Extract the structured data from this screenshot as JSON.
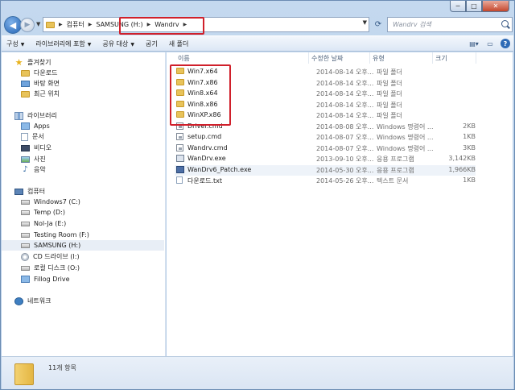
{
  "window": {
    "caption_buttons": {
      "minimize": "─",
      "maximize": "□",
      "close": "✕"
    }
  },
  "address": {
    "crumbs": [
      "컴퓨터",
      "SAMSUNG (H:)",
      "Wandrv"
    ],
    "search_placeholder": "Wandrv 검색"
  },
  "toolbar": {
    "items": [
      {
        "label": "구성",
        "has_caret": true
      },
      {
        "label": "라이브러리에 포함",
        "has_caret": true
      },
      {
        "label": "공유 대상",
        "has_caret": true
      },
      {
        "label": "굽기",
        "has_caret": false
      },
      {
        "label": "새 폴더",
        "has_caret": false
      }
    ]
  },
  "nav": {
    "favorites": {
      "label": "즐겨찾기",
      "items": [
        "다운로드",
        "바탕 화면",
        "최근 위치"
      ]
    },
    "libraries": {
      "label": "라이브러리",
      "items": [
        "Apps",
        "문서",
        "비디오",
        "사진",
        "음악"
      ]
    },
    "computer": {
      "label": "컴퓨터",
      "items": [
        "Windows7 (C:)",
        "Temp (D:)",
        "Nol-Ja (E:)",
        "Testing Room (F:)",
        "SAMSUNG (H:)",
        "CD 드라이브 (I:)",
        "로컬 디스크 (O:)",
        "Fillog Drive"
      ],
      "selected": "SAMSUNG (H:)"
    },
    "network": {
      "label": "네트워크"
    }
  },
  "columns": {
    "name": "이름",
    "date": "수정한 날짜",
    "type": "유형",
    "size": "크기"
  },
  "files": [
    {
      "name": "Win7.x64",
      "date": "2014-08-14 오후...",
      "type": "파일 폴더",
      "size": "",
      "icon": "folder-icon"
    },
    {
      "name": "Win7.x86",
      "date": "2014-08-14 오후...",
      "type": "파일 폴더",
      "size": "",
      "icon": "folder-icon"
    },
    {
      "name": "Win8.x64",
      "date": "2014-08-14 오후...",
      "type": "파일 폴더",
      "size": "",
      "icon": "folder-icon"
    },
    {
      "name": "Win8.x86",
      "date": "2014-08-14 오후...",
      "type": "파일 폴더",
      "size": "",
      "icon": "folder-icon"
    },
    {
      "name": "WinXP.x86",
      "date": "2014-08-14 오후...",
      "type": "파일 폴더",
      "size": "",
      "icon": "folder-icon"
    },
    {
      "name": "Driver.cmd",
      "date": "2014-08-08 오후...",
      "type": "Windows 명령어 ...",
      "size": "2KB",
      "icon": "cmd-icon"
    },
    {
      "name": "setup.cmd",
      "date": "2014-08-07 오후...",
      "type": "Windows 명령어 ...",
      "size": "1KB",
      "icon": "cmd-icon"
    },
    {
      "name": "Wandrv.cmd",
      "date": "2014-08-07 오후...",
      "type": "Windows 명령어 ...",
      "size": "3KB",
      "icon": "cmd-icon"
    },
    {
      "name": "WanDrv.exe",
      "date": "2013-09-10 오후...",
      "type": "응용 프로그램",
      "size": "3,142KB",
      "icon": "exe-icon"
    },
    {
      "name": "WanDrv6_Patch.exe",
      "date": "2014-05-30 오후...",
      "type": "응용 프로그램",
      "size": "1,966KB",
      "icon": "patch-exe-icon"
    },
    {
      "name": "다운로드.txt",
      "date": "2014-05-26 오후...",
      "type": "텍스트 문서",
      "size": "1KB",
      "icon": "text-file-icon"
    }
  ],
  "selected_file": "WanDrv6_Patch.exe",
  "status": {
    "item_count": "11개 항목"
  },
  "colors": {
    "highlight": "#d0202b",
    "folder": "#e8c35a",
    "selection": "#e8eef6"
  }
}
